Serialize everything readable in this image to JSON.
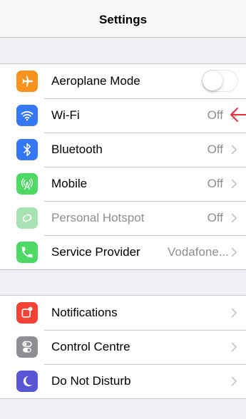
{
  "navbar": {
    "title": "Settings"
  },
  "group1": [
    {
      "label": "Aeroplane Mode",
      "icon": "airplane-icon",
      "color": "#f7931e",
      "toggle": false
    },
    {
      "label": "Wi-Fi",
      "icon": "wifi-icon",
      "color": "#3478f6",
      "value": "Off"
    },
    {
      "label": "Bluetooth",
      "icon": "bluetooth-icon",
      "color": "#3478f6",
      "value": "Off"
    },
    {
      "label": "Mobile",
      "icon": "antenna-icon",
      "color": "#4cd964",
      "value": "Off"
    },
    {
      "label": "Personal Hotspot",
      "icon": "hotspot-icon",
      "color": "#a8e2b3",
      "value": "Off",
      "disabled": true
    },
    {
      "label": "Service Provider",
      "icon": "phone-icon",
      "color": "#4cd964",
      "value": "Vodafone..."
    }
  ],
  "group2": [
    {
      "label": "Notifications",
      "icon": "notifications-icon",
      "color": "#f44336"
    },
    {
      "label": "Control Centre",
      "icon": "control-centre-icon",
      "color": "#8e8e93"
    },
    {
      "label": "Do Not Disturb",
      "icon": "moon-icon",
      "color": "#5856d6"
    }
  ],
  "colors": {
    "annotation_arrow": "#e8303a",
    "separator": "#c8c7cc",
    "background": "#efeff4"
  }
}
